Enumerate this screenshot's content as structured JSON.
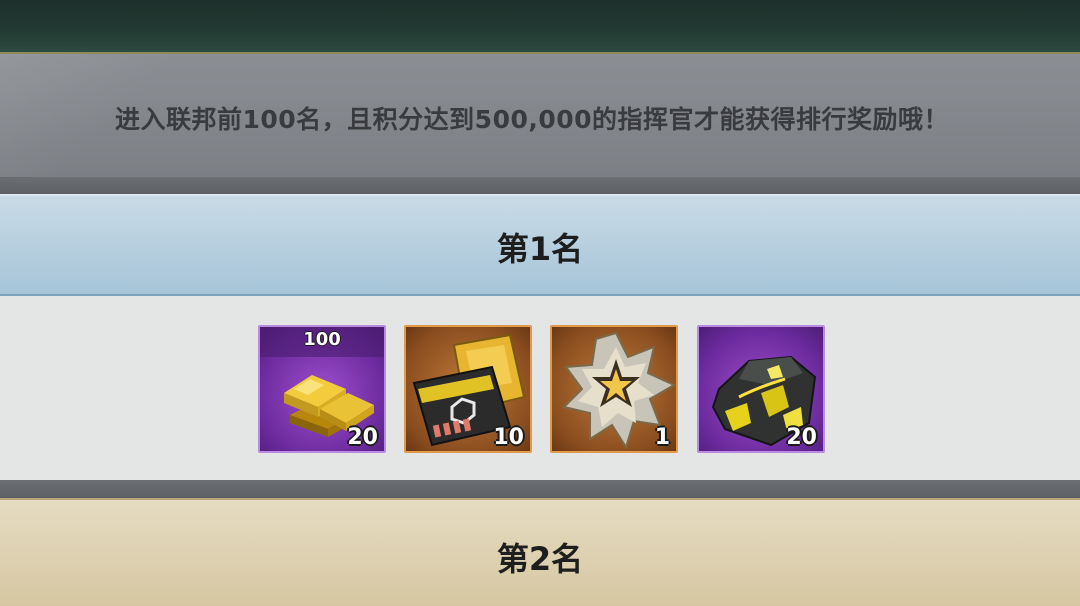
{
  "notice": {
    "text": "进入联邦前100名，且积分达到500,000的指挥官才能获得排行奖励哦！"
  },
  "ranks": [
    {
      "title": "第1名",
      "rewards": [
        {
          "icon": "gold-bars-icon",
          "tag": "100",
          "count": "20",
          "rarity": "purple"
        },
        {
          "icon": "senior-card-icon",
          "tag": "",
          "count": "10",
          "rarity": "orange"
        },
        {
          "icon": "star-medal-icon",
          "tag": "",
          "count": "1",
          "rarity": "orange"
        },
        {
          "icon": "crystal-ore-icon",
          "tag": "",
          "count": "20",
          "rarity": "purple"
        }
      ]
    },
    {
      "title": "第2名"
    }
  ],
  "colors": {
    "rank1_header": "#a6c4d8",
    "rank2_header": "#d6c7a2",
    "purple_frame": "#6a2a9c",
    "orange_frame": "#8a4d1f"
  }
}
